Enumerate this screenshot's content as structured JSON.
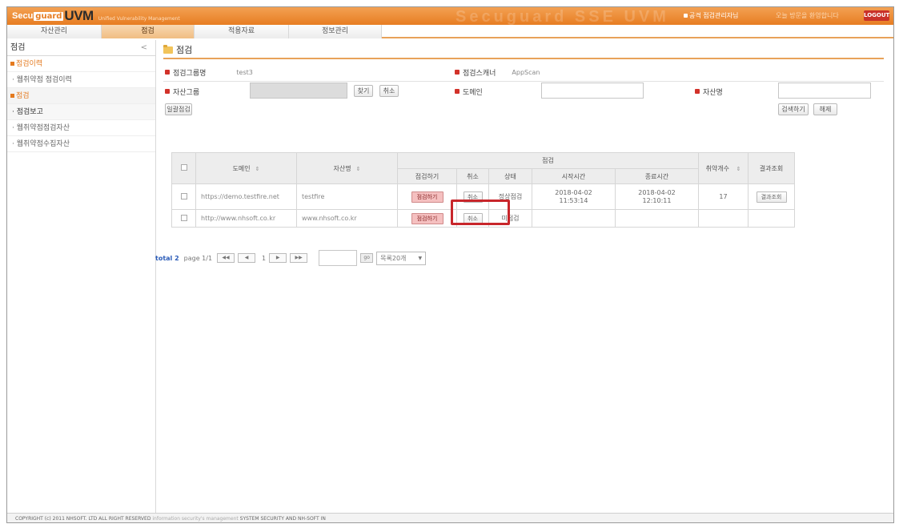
{
  "header": {
    "logo_secu": "Secu",
    "logo_guard": "guard",
    "logo_uvm": "UVM",
    "logo_sub": "Unified Vulnerability Management",
    "watermark": "Secuguard SSE UVM",
    "user_text": "공격 점검관리자님",
    "user_msg": "오늘 방문을 환영합니다",
    "logout_label": "LOGOUT"
  },
  "nav": {
    "tabs": [
      "자산관리",
      "점검",
      "적용자료",
      "정보관리"
    ],
    "active_index": 1
  },
  "sidebar": {
    "title": "점검",
    "collapse_glyph": "<",
    "group1": "점검이력",
    "item1": "웹취약점 점검이력",
    "group2": "점검",
    "item2": "점검보고",
    "item3": "웹취약점점검자산",
    "item4": "웹취약점수집자산"
  },
  "main": {
    "page_title": "점검",
    "group_name_label": "점검그룹명",
    "group_name_value": "test3",
    "scanner_label": "점검스캐너",
    "scanner_value": "AppScan",
    "asset_group_label": "자산그룹",
    "find_button": "찾기",
    "cancel_button": "취소",
    "domain_label": "도메인",
    "asset_name_label": "자산명",
    "batch_button": "일괄점검",
    "search_button": "검색하기",
    "reset_button": "해제"
  },
  "table": {
    "headers": {
      "domain": "도메인",
      "asset_name": "자산명",
      "inspection": "점검",
      "vuln_count": "취약개수",
      "result": "결과조회",
      "sub_inspect": "점검하기",
      "sub_cancel": "취소",
      "sub_status": "상태",
      "sub_start": "시작시간",
      "sub_end": "종료시간"
    },
    "rows": [
      {
        "domain": "https://demo.testfire.net",
        "asset_name": "testfire",
        "inspect": "점검하기",
        "cancel": "취소",
        "status": "정상점검",
        "start": "2018-04-02 11:53:14",
        "end": "2018-04-02 12:10:11",
        "vuln_count": "17",
        "result": "결과조회"
      },
      {
        "domain": "http://www.nhsoft.co.kr",
        "asset_name": "www.nhsoft.co.kr",
        "inspect": "점검하기",
        "cancel": "취소",
        "status": "미점검",
        "start": "",
        "end": "",
        "vuln_count": "",
        "result": ""
      }
    ]
  },
  "pager": {
    "total": "total 2",
    "page": "page 1/1",
    "first": "◀◀",
    "prev": "◀",
    "current": "1",
    "next": "▶",
    "last": "▶▶",
    "go": "go",
    "per_page": "목록20개"
  },
  "footer": {
    "copyright": "COPYRIGHT (c) 2011 NHSOFT. LTD ALL RIGHT RESERVED",
    "tagline": "information security's management",
    "system": "SYSTEM SECURITY AND NH-SOFT IN"
  },
  "colors": {
    "accent": "#e77d22",
    "highlight": "#c8262b",
    "required_dot": "#d2322a"
  }
}
